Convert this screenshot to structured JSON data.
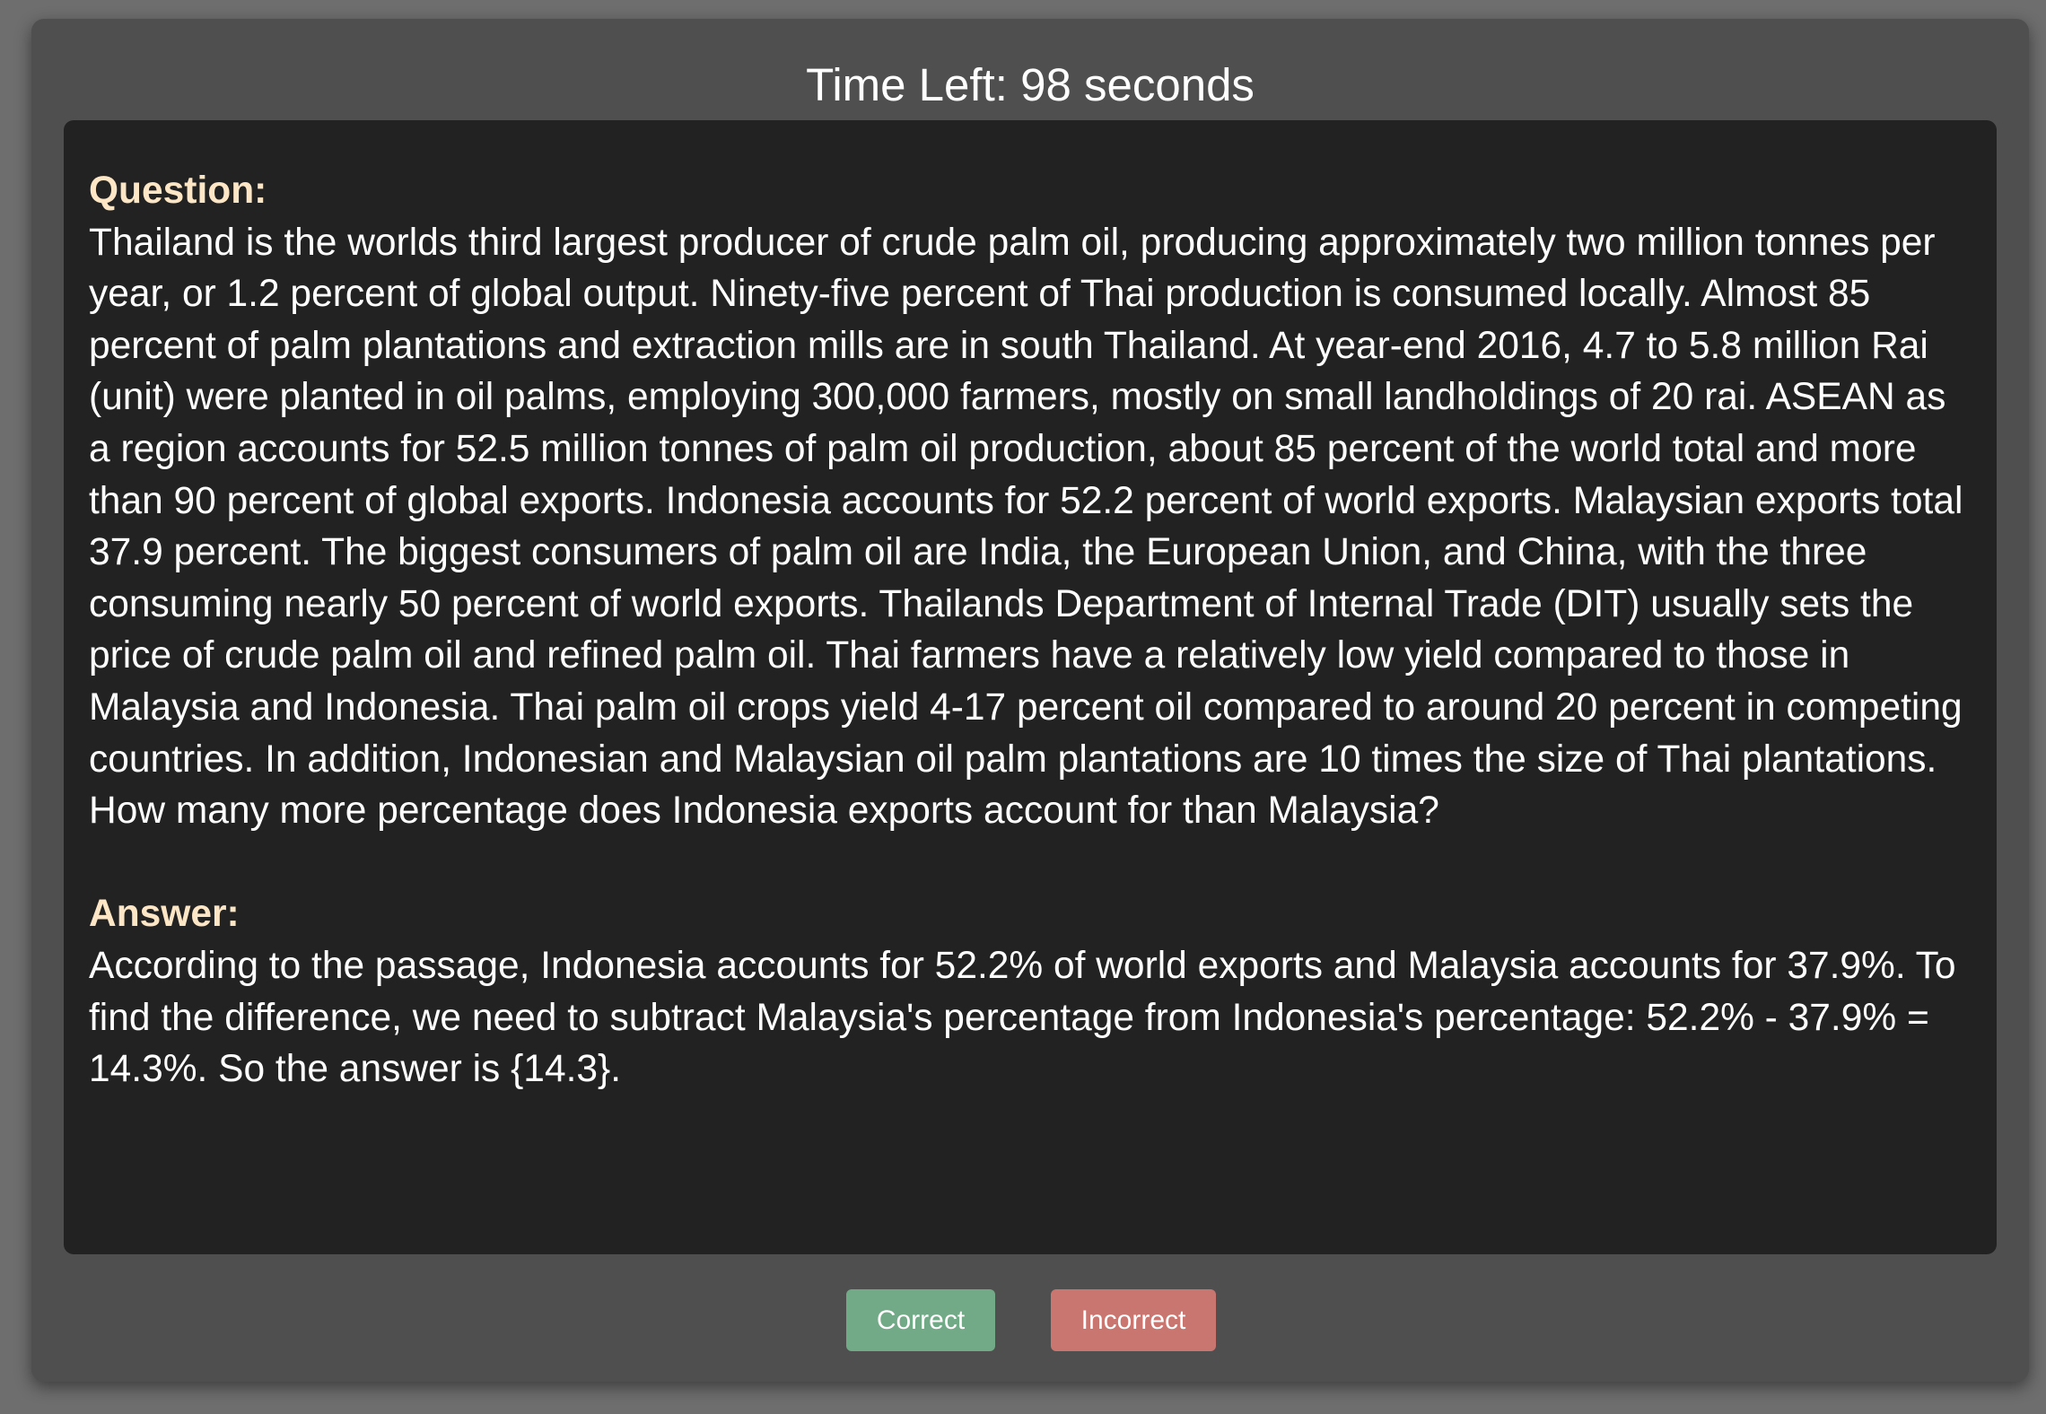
{
  "timer": {
    "text": "Time Left: 98 seconds"
  },
  "question": {
    "label": "Question:",
    "text": "Thailand is the worlds third largest producer of crude palm oil, producing approximately two million tonnes per year, or 1.2 percent of global output. Ninety-five percent of Thai production is consumed locally. Almost 85 percent of palm plantations and extraction mills are in south Thailand. At year-end 2016, 4.7 to 5.8 million Rai (unit) were planted in oil palms, employing 300,000 farmers, mostly on small landholdings of 20 rai. ASEAN as a region accounts for 52.5 million tonnes of palm oil production, about 85 percent of the world total and more than 90 percent of global exports. Indonesia accounts for 52.2 percent of world exports. Malaysian exports total 37.9 percent. The biggest consumers of palm oil are India, the European Union, and China, with the three consuming nearly 50 percent of world exports. Thailands Department of Internal Trade (DIT) usually sets the price of crude palm oil and refined palm oil. Thai farmers have a relatively low yield compared to those in Malaysia and Indonesia. Thai palm oil crops yield 4-17 percent oil compared to around 20 percent in competing countries. In addition, Indonesian and Malaysian oil palm plantations are 10 times the size of Thai plantations. How many more percentage does Indonesia exports account for than Malaysia?"
  },
  "answer": {
    "label": "Answer:",
    "text": "According to the passage, Indonesia accounts for 52.2% of world exports and Malaysia accounts for 37.9%. To find the difference, we need to subtract Malaysia's percentage from Indonesia's percentage: 52.2% - 37.9% = 14.3%. So the answer is {14.3}."
  },
  "buttons": {
    "correct_label": "Correct",
    "incorrect_label": "Incorrect"
  },
  "colors": {
    "label": "#fde6c6",
    "correct": "#72a986",
    "incorrect": "#c97671"
  }
}
